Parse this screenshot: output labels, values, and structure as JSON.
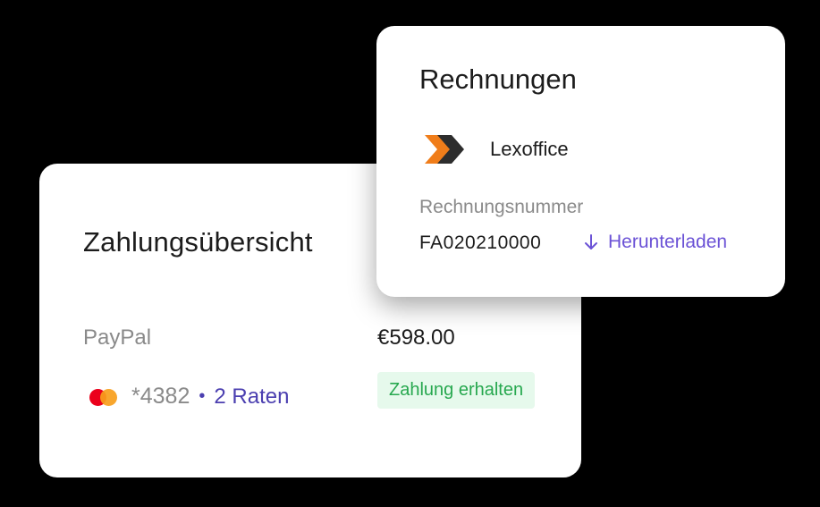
{
  "payment_card": {
    "title": "Zahlungsübersicht",
    "method": "PayPal",
    "amount": "€598.00",
    "card_number": "*4382",
    "separator": "•",
    "installments": "2 Raten",
    "status": "Zahlung erhalten",
    "card_icon": "mastercard-icon"
  },
  "invoice_card": {
    "title": "Rechnungen",
    "provider": "Lexoffice",
    "provider_icon": "lexoffice-logo-icon",
    "number_label": "Rechnungsnummer",
    "number": "FA020210000",
    "download_label": "Herunterladen",
    "download_icon": "arrow-down-icon"
  },
  "colors": {
    "background": "#000000",
    "accent_purple": "#6b52d6",
    "success_green": "#27a84f",
    "success_bg": "#e6f9ec",
    "lexoffice_orange": "#f07d1a",
    "lexoffice_dark": "#2d2d2d"
  }
}
